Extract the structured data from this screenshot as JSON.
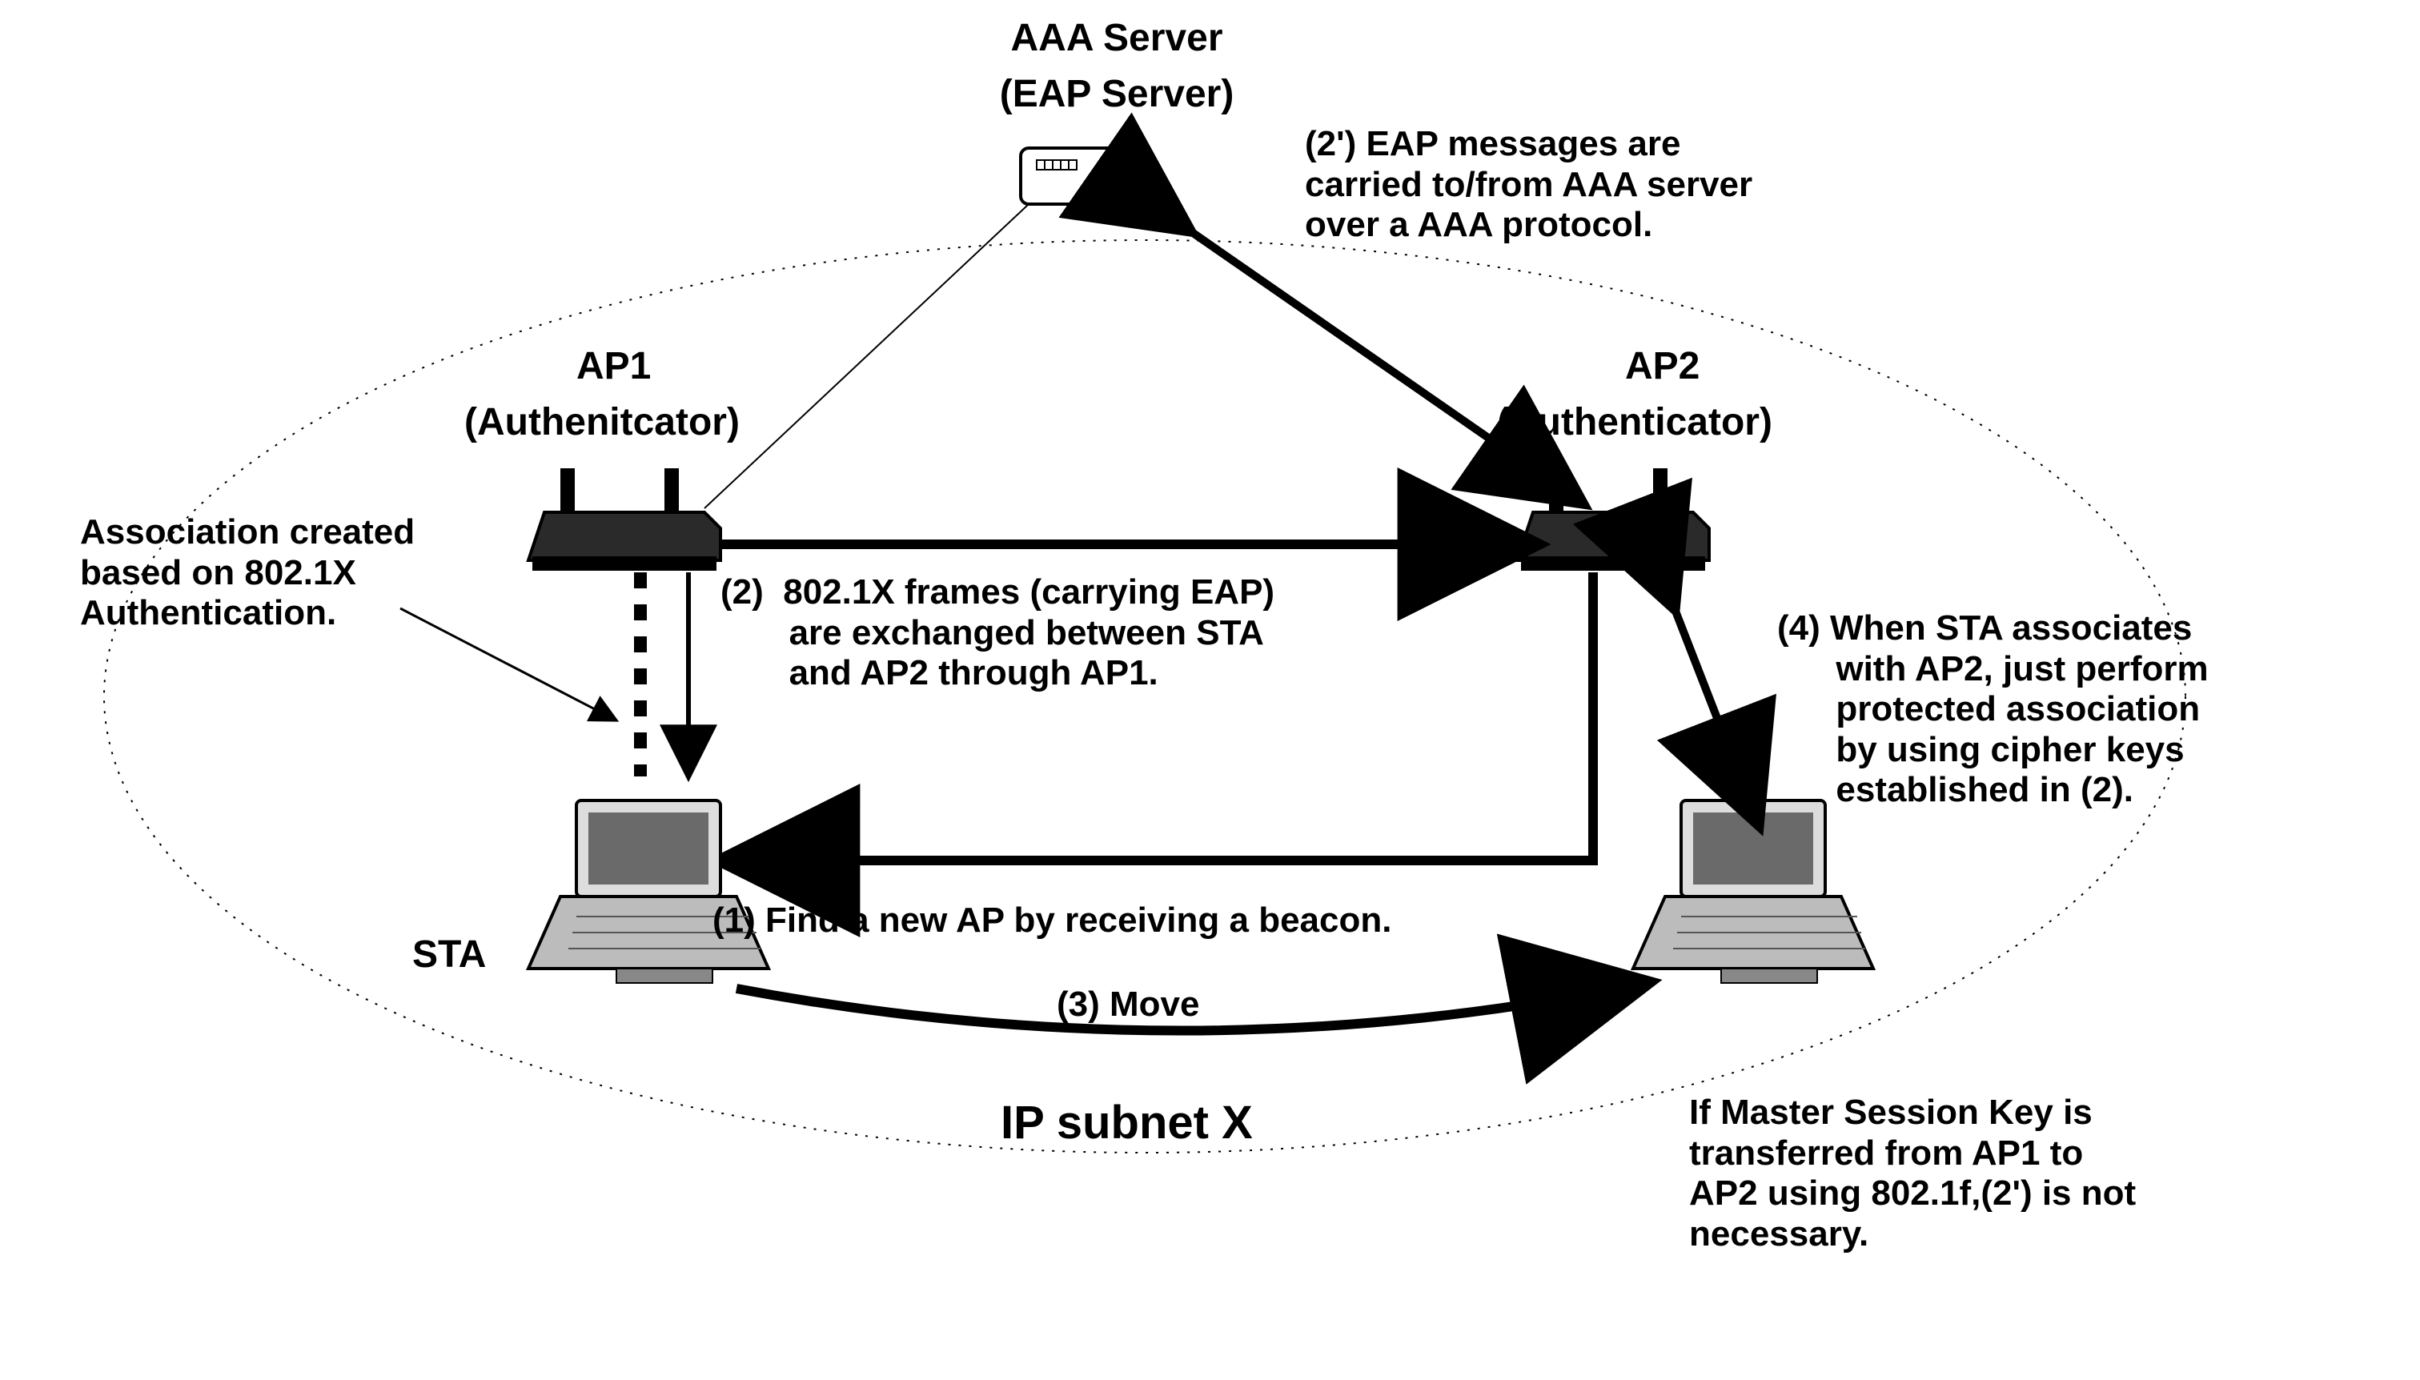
{
  "server": {
    "title_line1": "AAA Server",
    "title_line2": "(EAP Server)"
  },
  "ap1": {
    "title_line1": "AP1",
    "title_line2": "(Authenitcator)"
  },
  "ap2": {
    "title_line1": "AP2",
    "title_line2": "(Authenticator)"
  },
  "sta": {
    "label": "STA"
  },
  "subnet": {
    "label": "IP subnet X"
  },
  "notes": {
    "assoc_created": "Association created\nbased on 802.1X\nAuthentication.",
    "eap_carry": "(2') EAP messages are\ncarried to/from AAA server\nover a AAA protocol.",
    "step1": "(1) Find a new AP by receiving a beacon.",
    "step2": "(2)  802.1X frames (carrying EAP)\n       are exchanged between STA\n       and AP2 through AP1.",
    "step3": "(3) Move",
    "step4": "(4) When STA associates\n      with AP2, just perform\n      protected association\n      by using cipher keys\n      established in (2).",
    "msk_note": "If Master Session Key is\ntransferred from AP1 to\nAP2 using 802.1f,(2') is not\nnecessary."
  }
}
